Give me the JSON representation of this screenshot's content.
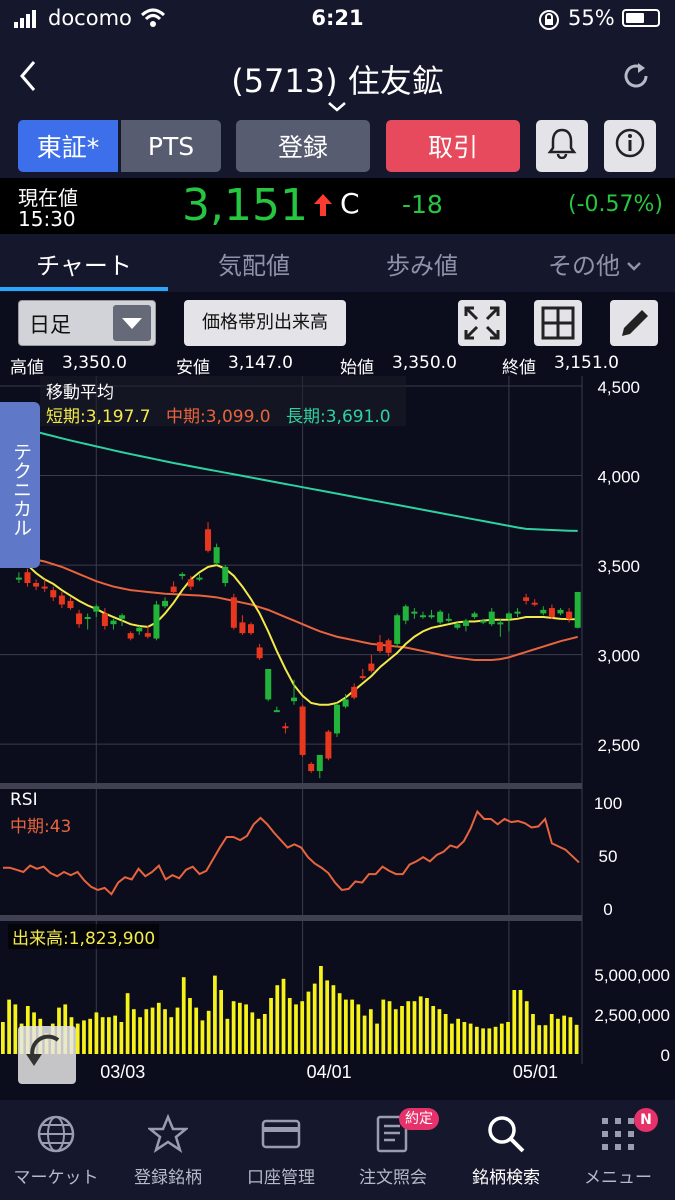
{
  "status": {
    "carrier": "docomo",
    "time": "6:21",
    "battery": "55%"
  },
  "nav": {
    "title": "(5713) 住友鉱"
  },
  "buttons": {
    "market1": "東証*",
    "market2": "PTS",
    "register": "登録",
    "trade": "取引"
  },
  "price": {
    "label": "現在値",
    "time": "15:30",
    "value": "3,151",
    "flag": "C",
    "change": "-18",
    "change_pct": "(-0.57%)"
  },
  "tabs": [
    "チャート",
    "気配値",
    "歩み値",
    "その他"
  ],
  "tools": {
    "period": "日足",
    "volume_profile": "価格帯別出来高"
  },
  "ohlc": {
    "high_label": "高値",
    "high": "3,350.0",
    "low_label": "安値",
    "low": "3,147.0",
    "open_label": "始値",
    "open": "3,350.0",
    "close_label": "終値",
    "close": "3,151.0"
  },
  "side_tab": "テクニカル",
  "chart_data": [
    {
      "type": "candlestick",
      "title": "移動平均",
      "legend": {
        "short": "短期:3,197.7",
        "mid": "中期:3,099.0",
        "long": "長期:3,691.0"
      },
      "ylim": [
        2300,
        4500
      ],
      "yticks": [
        "4,500",
        "4,000",
        "3,500",
        "3,000",
        "2,500"
      ],
      "ytick_values": [
        4500,
        4000,
        3500,
        3000,
        2500
      ],
      "xticks": [
        "03/03",
        "04/01",
        "05/01"
      ],
      "xtick_index": [
        10,
        34,
        58
      ],
      "colors": {
        "up": "#22b33a",
        "down": "#e8371f",
        "short": "#f3ea4a",
        "mid": "#e8643c",
        "long": "#2ed2a0"
      },
      "candles": [
        [
          3550,
          3700,
          3550,
          3690
        ],
        [
          3420,
          3460,
          3400,
          3430
        ],
        [
          3460,
          3480,
          3380,
          3400
        ],
        [
          3400,
          3420,
          3360,
          3380
        ],
        [
          3380,
          3420,
          3350,
          3370
        ],
        [
          3360,
          3380,
          3300,
          3320
        ],
        [
          3330,
          3350,
          3260,
          3280
        ],
        [
          3300,
          3320,
          3250,
          3260
        ],
        [
          3230,
          3250,
          3150,
          3170
        ],
        [
          3200,
          3230,
          3140,
          3210
        ],
        [
          3240,
          3280,
          3210,
          3270
        ],
        [
          3230,
          3260,
          3140,
          3160
        ],
        [
          3170,
          3200,
          3140,
          3190
        ],
        [
          3200,
          3230,
          3160,
          3220
        ],
        [
          3120,
          3130,
          3080,
          3090
        ],
        [
          3130,
          3160,
          3110,
          3150
        ],
        [
          3120,
          3160,
          3090,
          3100
        ],
        [
          3090,
          3300,
          3080,
          3280
        ],
        [
          3270,
          3320,
          3260,
          3300
        ],
        [
          3380,
          3410,
          3340,
          3350
        ],
        [
          3450,
          3460,
          3420,
          3450
        ],
        [
          3420,
          3440,
          3360,
          3380
        ],
        [
          3420,
          3450,
          3410,
          3430
        ],
        [
          3700,
          3740,
          3570,
          3580
        ],
        [
          3510,
          3620,
          3500,
          3600
        ],
        [
          3400,
          3500,
          3380,
          3490
        ],
        [
          3320,
          3340,
          3140,
          3150
        ],
        [
          3180,
          3220,
          3110,
          3120
        ],
        [
          3170,
          3180,
          3110,
          3120
        ],
        [
          3040,
          3060,
          2970,
          2980
        ],
        [
          2750,
          2920,
          2740,
          2920
        ],
        [
          2690,
          2710,
          2680,
          2690
        ],
        [
          2600,
          2620,
          2560,
          2590
        ],
        [
          2740,
          2860,
          2720,
          2760
        ],
        [
          2710,
          2720,
          2430,
          2440
        ],
        [
          2390,
          2400,
          2340,
          2350
        ],
        [
          2350,
          2440,
          2310,
          2440
        ],
        [
          2570,
          2580,
          2410,
          2420
        ],
        [
          2560,
          2730,
          2540,
          2720
        ],
        [
          2710,
          2780,
          2700,
          2750
        ],
        [
          2820,
          2840,
          2750,
          2760
        ],
        [
          2880,
          2920,
          2860,
          2870
        ],
        [
          2950,
          3000,
          2900,
          2910
        ],
        [
          3070,
          3110,
          3010,
          3020
        ],
        [
          3080,
          3090,
          2990,
          3010
        ],
        [
          3060,
          3230,
          3040,
          3220
        ],
        [
          3190,
          3280,
          3170,
          3270
        ],
        [
          3230,
          3260,
          3200,
          3240
        ],
        [
          3210,
          3240,
          3200,
          3220
        ],
        [
          3210,
          3250,
          3200,
          3220
        ],
        [
          3180,
          3250,
          3170,
          3240
        ],
        [
          3190,
          3230,
          3180,
          3200
        ],
        [
          3150,
          3180,
          3140,
          3170
        ],
        [
          3160,
          3200,
          3130,
          3190
        ],
        [
          3210,
          3240,
          3200,
          3230
        ],
        [
          3180,
          3200,
          3170,
          3190
        ],
        [
          3170,
          3260,
          3160,
          3240
        ],
        [
          3170,
          3200,
          3100,
          3180
        ],
        [
          3200,
          3240,
          3130,
          3230
        ],
        [
          3230,
          3260,
          3210,
          3240
        ],
        [
          3320,
          3340,
          3280,
          3300
        ],
        [
          3290,
          3310,
          3270,
          3280
        ],
        [
          3230,
          3270,
          3220,
          3250
        ],
        [
          3260,
          3280,
          3200,
          3210
        ],
        [
          3230,
          3260,
          3220,
          3250
        ],
        [
          3240,
          3260,
          3180,
          3200
        ],
        [
          3150,
          3350,
          3147,
          3350
        ]
      ],
      "ma_short": [
        3590,
        3550,
        3500,
        3455,
        3420,
        3395,
        3360,
        3330,
        3300,
        3275,
        3255,
        3230,
        3210,
        3190,
        3170,
        3160,
        3155,
        3180,
        3230,
        3290,
        3360,
        3420,
        3460,
        3490,
        3500,
        3480,
        3440,
        3380,
        3310,
        3230,
        3130,
        3020,
        2920,
        2830,
        2770,
        2730,
        2720,
        2720,
        2730,
        2760,
        2800,
        2840,
        2880,
        2930,
        2970,
        3010,
        3060,
        3100,
        3130,
        3150,
        3160,
        3170,
        3180,
        3185,
        3185,
        3190,
        3195,
        3195,
        3195,
        3200,
        3210,
        3210,
        3210,
        3205,
        3200,
        3198,
        3197.7
      ],
      "ma_mid": [
        3550,
        3545,
        3540,
        3530,
        3520,
        3505,
        3490,
        3470,
        3450,
        3430,
        3410,
        3395,
        3380,
        3370,
        3360,
        3355,
        3350,
        3345,
        3340,
        3338,
        3335,
        3332,
        3330,
        3325,
        3320,
        3310,
        3300,
        3290,
        3280,
        3265,
        3250,
        3230,
        3210,
        3190,
        3170,
        3150,
        3130,
        3115,
        3100,
        3090,
        3080,
        3070,
        3060,
        3055,
        3050,
        3045,
        3040,
        3030,
        3020,
        3010,
        3000,
        2990,
        2982,
        2976,
        2970,
        2970,
        2970,
        2975,
        2985,
        3000,
        3015,
        3030,
        3045,
        3060,
        3075,
        3087,
        3099
      ],
      "ma_long": [
        4290,
        4275,
        4260,
        4245,
        4232,
        4220,
        4208,
        4196,
        4185,
        4174,
        4163,
        4152,
        4141,
        4130,
        4120,
        4110,
        4100,
        4090,
        4080,
        4070,
        4061,
        4052,
        4043,
        4034,
        4025,
        4016,
        4007,
        3998,
        3989,
        3980,
        3971,
        3962,
        3953,
        3944,
        3935,
        3926,
        3917,
        3908,
        3899,
        3890,
        3881,
        3872,
        3863,
        3854,
        3845,
        3836,
        3827,
        3818,
        3809,
        3800,
        3791,
        3782,
        3773,
        3764,
        3755,
        3746,
        3737,
        3728,
        3719,
        3710,
        3702,
        3700,
        3698,
        3696,
        3694,
        3692,
        3691
      ]
    },
    {
      "type": "line",
      "title": "RSI",
      "legend": "中期:43",
      "ylim": [
        0,
        100
      ],
      "yticks": [
        "100",
        "50",
        "0"
      ],
      "ytick_values": [
        100,
        50,
        0
      ],
      "values": [
        38,
        38,
        36,
        34,
        40,
        37,
        39,
        33,
        30,
        34,
        31,
        34,
        26,
        20,
        17,
        19,
        13,
        24,
        29,
        27,
        37,
        30,
        34,
        40,
        27,
        31,
        28,
        36,
        39,
        32,
        35,
        46,
        57,
        67,
        67,
        64,
        68,
        79,
        85,
        79,
        71,
        64,
        57,
        60,
        57,
        48,
        42,
        38,
        33,
        24,
        17,
        18,
        25,
        24,
        32,
        32,
        39,
        35,
        32,
        32,
        41,
        44,
        48,
        44,
        50,
        53,
        59,
        57,
        63,
        75,
        91,
        84,
        84,
        79,
        84,
        81,
        82,
        80,
        76,
        77,
        84,
        61,
        58,
        55,
        49,
        43
      ]
    },
    {
      "type": "bar",
      "title": "出来高",
      "legend": "出来高:1,823,900",
      "ylim": [
        0,
        6000000
      ],
      "yticks": [
        "5,000,000",
        "2,500,000",
        "0"
      ],
      "ytick_values": [
        5000000,
        2500000,
        0
      ],
      "values": [
        2000000,
        3400000,
        3100000,
        1900000,
        3000000,
        2600000,
        2200000,
        1300000,
        1900000,
        2900000,
        3100000,
        2300000,
        1900000,
        2100000,
        2200000,
        2600000,
        2300000,
        2300000,
        2400000,
        2000000,
        3800000,
        2800000,
        2300000,
        2800000,
        2900000,
        3200000,
        2800000,
        2300000,
        2900000,
        4800000,
        3500000,
        2900000,
        2100000,
        2700000,
        4900000,
        4000000,
        2200000,
        3300000,
        3200000,
        3100000,
        2600000,
        2200000,
        2500000,
        3500000,
        4300000,
        4700000,
        3500000,
        3100000,
        3300000,
        3900000,
        4400000,
        5500000,
        4600000,
        4300000,
        3800000,
        3400000,
        3400000,
        3100000,
        2400000,
        2800000,
        1900000,
        3400000,
        3300000,
        2800000,
        3000000,
        3300000,
        3300000,
        3600000,
        3500000,
        3000000,
        2800000,
        2500000,
        1900000,
        2200000,
        2000000,
        1900000,
        1700000,
        1600000,
        1600000,
        1700000,
        1900000,
        2000000,
        4000000,
        4000000,
        3300000,
        2500000,
        1800000,
        1800000,
        2500000,
        2200000,
        2400000,
        2300000,
        1823900
      ],
      "xticks": [
        "03/03",
        "04/01",
        "05/01"
      ],
      "xtick_index": [
        10,
        34,
        58
      ]
    }
  ],
  "tabbar": [
    "マーケット",
    "登録銘柄",
    "口座管理",
    "注文照会",
    "銘柄検索",
    "メニュー"
  ],
  "badges": {
    "orders": "約定",
    "menu": "N"
  }
}
